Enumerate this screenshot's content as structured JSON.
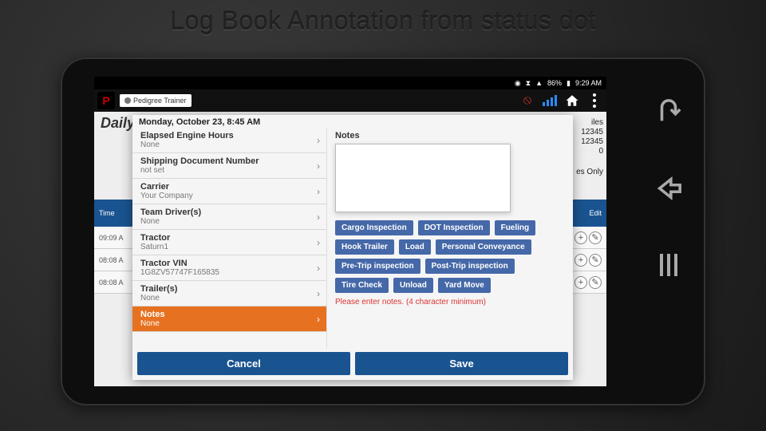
{
  "slide": {
    "title": "Log Book Annotation from status dot"
  },
  "status_bar": {
    "battery": "86%",
    "time": "9:29 AM"
  },
  "app_bar": {
    "driver_name": "Pedigree Trainer"
  },
  "bg_daily": {
    "label": "Daily",
    "miles_label": "iles",
    "val1": "12345",
    "val2": "12345",
    "val3": "0",
    "opt": "es Only",
    "band_left": "Time",
    "band_right": "Edit",
    "rows": [
      "09:09 A",
      "08:08 A",
      "08:08 A"
    ]
  },
  "modal": {
    "header": "Monday, October 23, 8:45 AM",
    "fields": [
      {
        "label": "Elapsed Engine Hours",
        "value": "None"
      },
      {
        "label": "Shipping Document Number",
        "value": "not set"
      },
      {
        "label": "Carrier",
        "value": "Your Company"
      },
      {
        "label": "Team Driver(s)",
        "value": "None"
      },
      {
        "label": "Tractor",
        "value": "Saturn1"
      },
      {
        "label": "Tractor VIN",
        "value": "1G8ZV57747F165835"
      },
      {
        "label": "Trailer(s)",
        "value": "None"
      },
      {
        "label": "Notes",
        "value": "None",
        "selected": true
      }
    ],
    "notes_heading": "Notes",
    "tags": [
      "Cargo Inspection",
      "DOT Inspection",
      "Fueling",
      "Hook Trailer",
      "Load",
      "Personal Conveyance",
      "Pre-Trip inspection",
      "Post-Trip inspection",
      "Tire Check",
      "Unload",
      "Yard Move"
    ],
    "hint": "Please enter notes. (4 character minimum)",
    "cancel": "Cancel",
    "save": "Save"
  }
}
